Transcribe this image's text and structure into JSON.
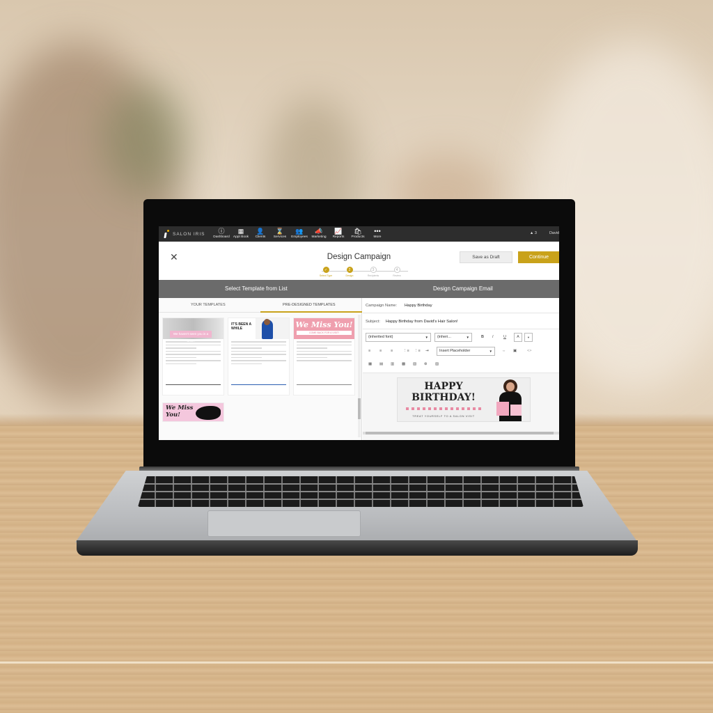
{
  "app": {
    "logo_text": "SALON IRIS",
    "nav": [
      {
        "label": "Dashboard",
        "icon": "info-icon",
        "glyph": "ⓘ"
      },
      {
        "label": "Appt Book",
        "icon": "calendar-icon",
        "glyph": "▦"
      },
      {
        "label": "Clients",
        "icon": "clients-icon",
        "glyph": "👤"
      },
      {
        "label": "Services",
        "icon": "hourglass-icon",
        "glyph": "⌛"
      },
      {
        "label": "Employees",
        "icon": "employees-icon",
        "glyph": "👥"
      },
      {
        "label": "Marketing",
        "icon": "megaphone-icon",
        "glyph": "📣"
      },
      {
        "label": "Reports",
        "icon": "chart-icon",
        "glyph": "📈"
      },
      {
        "label": "Products",
        "icon": "bag-icon",
        "glyph": "🛍"
      },
      {
        "label": "More",
        "icon": "more-icon",
        "glyph": "•••"
      }
    ],
    "user_count": "3",
    "user_name": "David"
  },
  "header": {
    "title": "Design Campaign",
    "save_draft": "Save as Draft",
    "continue": "Continue",
    "steps": [
      {
        "label": "Select Type",
        "state": "done",
        "mark": "✓"
      },
      {
        "label": "Design",
        "state": "active",
        "mark": "2"
      },
      {
        "label": "Recipients",
        "state": "todo",
        "mark": "3"
      },
      {
        "label": "Review",
        "state": "todo",
        "mark": "4"
      }
    ]
  },
  "panels": {
    "left_title": "Select Template from List",
    "right_title": "Design Campaign Email"
  },
  "templates": {
    "tab_yours": "YOUR TEMPLATES",
    "tab_predesigned": "PRE-DESIGNED TEMPLATES",
    "t1_caption": "We haven't seen you in a while!",
    "t2_caption": "IT'S BEEN A WHILE",
    "t3_caption": "We Miss You!",
    "t3_sub": "COME BACK FOR A VISIT!",
    "t4_caption": "We Miss You!"
  },
  "form": {
    "campaign_name_label": "Campaign Name:",
    "campaign_name_value": "Happy Birthday",
    "subject_label": "Subject:",
    "subject_value": "Happy Birthday from David's Hair Salon!",
    "font_select": "(inherited font)",
    "size_select": "(inheri...",
    "bold": "B",
    "italic": "I",
    "underline": "U",
    "font_color": "A",
    "placeholder_select": "Insert Placeholder",
    "source": "<>"
  },
  "banner": {
    "headline": "HAPPY BIRTHDAY!",
    "tagline": "TREAT YOURSELF TO A SALON VISIT"
  },
  "colors": {
    "accent": "#c9a21a",
    "topbar": "#2d2d2d",
    "panelbar": "#6b6b6b"
  }
}
